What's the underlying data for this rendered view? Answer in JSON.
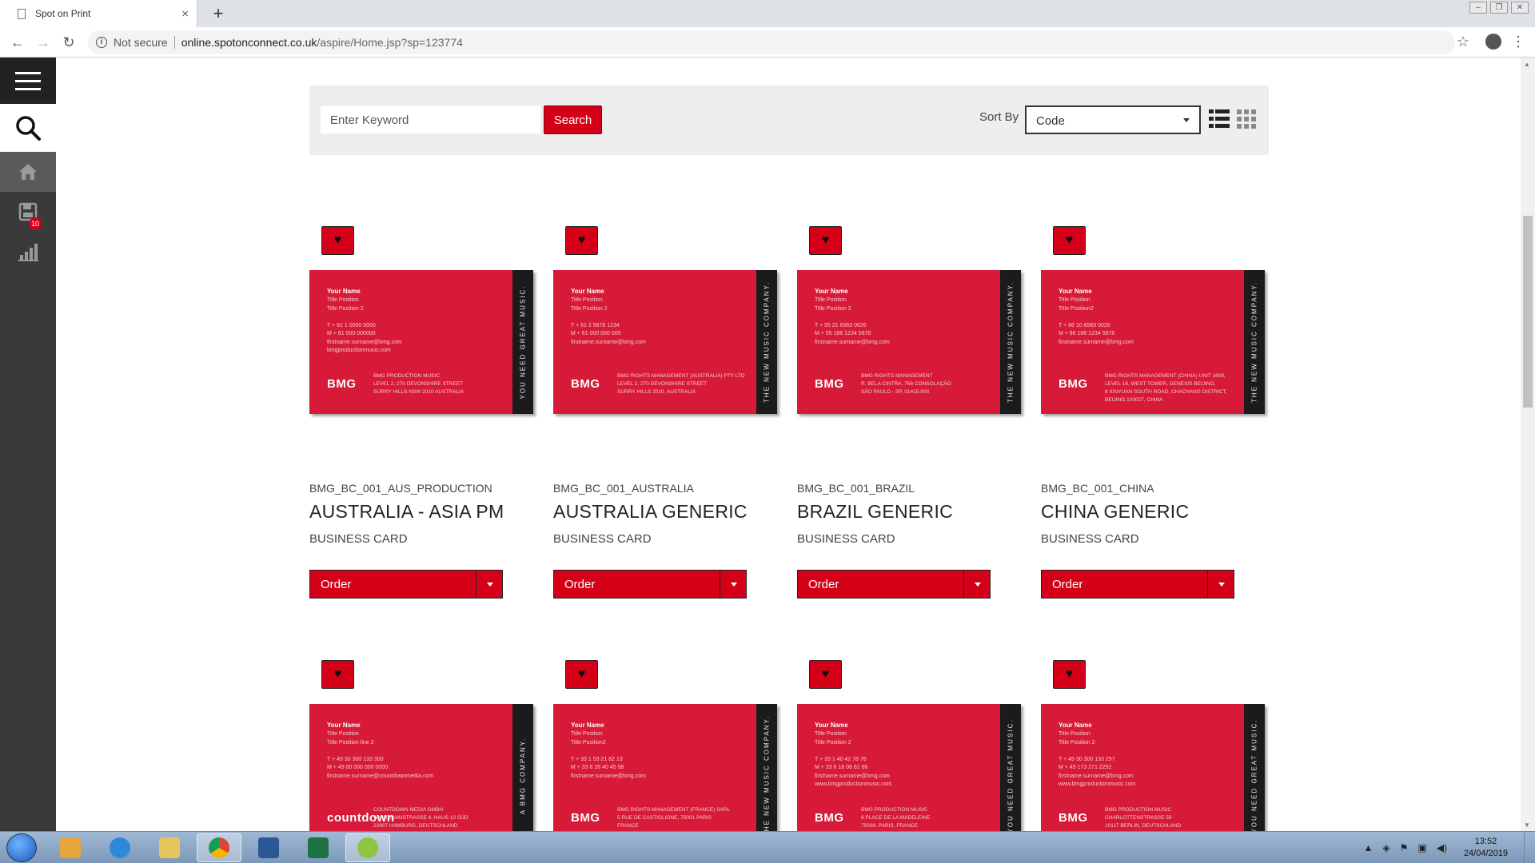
{
  "browser": {
    "tab_title": "Spot on Print",
    "tab_close": "×",
    "new_tab": "+",
    "not_secure": "Not secure",
    "url_host": "online.spotonconnect.co.uk",
    "url_path": "/aspire/Home.jsp?sp=123774"
  },
  "sidebar": {
    "cart_badge": "10"
  },
  "search": {
    "placeholder": "Enter Keyword",
    "button": "Search",
    "sort_label": "Sort By",
    "sort_value": "Code"
  },
  "products": [
    {
      "code": "BMG_BC_001_AUS_PRODUCTION",
      "name": "AUSTRALIA - ASIA PM",
      "type": "BUSINESS CARD",
      "order_label": "Order",
      "card": {
        "person": "Your Name",
        "lines": [
          "Title Position",
          "Title Position 2",
          "",
          "T  + 61 1 0000 0000",
          "M + 61 000 000000",
          "firstname.surname@bmg.com",
          "bmgproductionmusic.com"
        ],
        "logo": "BMG",
        "address": [
          "BMG PRODUCTION MUSIC",
          "LEVEL 2, 270 DEVONSHIRE STREET",
          "SURRY HILLS NSW 2010 AUSTRALIA"
        ],
        "stripe": "YOU NEED GREAT MUSIC."
      }
    },
    {
      "code": "BMG_BC_001_AUSTRALIA",
      "name": "AUSTRALIA GENERIC",
      "type": "BUSINESS CARD",
      "order_label": "Order",
      "card": {
        "person": "Your Name",
        "lines": [
          "Title Position",
          "Title Position 2",
          "",
          "T  + 61 2 5678 1234",
          "M + 61 000 000 000",
          "firstname.surname@bmg.com"
        ],
        "logo": "BMG",
        "address": [
          "BMG RIGHTS MANAGEMENT (AUSTRALIA) PTY LTD",
          "LEVEL 2, 270 DEVONSHIRE STREET",
          "SURRY HILLS 2010, AUSTRALIA"
        ],
        "stripe": "THE NEW MUSIC COMPANY."
      }
    },
    {
      "code": "BMG_BC_001_BRAZIL",
      "name": "BRAZIL GENERIC",
      "type": "BUSINESS CARD",
      "order_label": "Order",
      "card": {
        "person": "Your Name",
        "lines": [
          "Title Position",
          "Title Position 2",
          "",
          "T  + 55 21 6563 0026",
          "M + 55 186 1234 5678",
          "firstname.surname@bmg.com"
        ],
        "logo": "BMG",
        "address": [
          "BMG RIGHTS MANAGEMENT",
          "R. BELA CINTRA, 768 CONSOLAÇÃO",
          "SÃO PAULO - SP, 01415-000"
        ],
        "stripe": "THE NEW MUSIC COMPANY."
      }
    },
    {
      "code": "BMG_BC_001_CHINA",
      "name": "CHINA GENERIC",
      "type": "BUSINESS CARD",
      "order_label": "Order",
      "card": {
        "person": "Your Name",
        "lines": [
          "Title Position",
          "Title Position2",
          "",
          "T  + 86 10 6563 0026",
          "M + 86 186 1234 5678",
          "firstname.surname@bmg.com"
        ],
        "logo": "BMG",
        "address": [
          "BMG RIGHTS MANAGEMENT (CHINA) UNIT 1609,",
          "LEVEL 16, WEST TOWER, GENESIS BEIJING,",
          "8 XINYUAN SOUTH ROAD, CHAOYANG DISTRICT,",
          "BEIJING 100027, CHINA"
        ],
        "stripe": "THE NEW MUSIC COMPANY."
      }
    },
    {
      "card": {
        "person": "Your Name",
        "lines": [
          "Title Position",
          "Title Position line 2",
          "",
          "T  + 49 30 300 133 300",
          "M + 49 00 000 000 0000",
          "firstname.surname@countdownmedia.com"
        ],
        "logo": "countdown",
        "address": [
          "COUNTDOWN MEDIA GMBH",
          "WICHMANNSTRASSE 4, HAUS 10 SÜD",
          "22607 HAMBURG, DEUTSCHLAND"
        ],
        "stripe": "A BMG COMPANY."
      }
    },
    {
      "card": {
        "person": "Your Name",
        "lines": [
          "Title Position",
          "Title Position2",
          "",
          "T  + 33 1 53 21 82 13",
          "M + 33 6 28 40 45 98",
          "firstname.surname@bmg.com"
        ],
        "logo": "BMG",
        "address": [
          "BMG RIGHTS MANAGEMENT (FRANCE) SARL",
          "5 RUE DE CASTIGLIONE, 75001 PARIS",
          "FRANCE"
        ],
        "stripe": "THE NEW MUSIC COMPANY."
      }
    },
    {
      "card": {
        "person": "Your Name",
        "lines": [
          "Title Position",
          "Title Position 2",
          "",
          "T  + 33 1 40 42 78 76",
          "M + 33 6 18 06 62 86",
          "firstname.surname@bmg.com",
          "www.bmgproductionmusic.com"
        ],
        "logo": "BMG",
        "address": [
          "BMG PRODUCTION MUSIC",
          "8 PLACE DE LA MADELEINE",
          "75008, PARIS, FRANCE"
        ],
        "stripe": "YOU NEED GREAT MUSIC."
      }
    },
    {
      "card": {
        "person": "Your Name",
        "lines": [
          "Title Position",
          "Title Position 2",
          "",
          "T  + 49 30 300 133 257",
          "M + 49 173 271 2292",
          "firstname.surname@bmg.com",
          "www.bmgproductionmusic.com"
        ],
        "logo": "BMG",
        "address": [
          "BMG PRODUCTION MUSIC",
          "CHARLOTTENSTRASSE 59",
          "10117 BERLIN, DEUTSCHLAND"
        ],
        "stripe": "YOU NEED GREAT MUSIC."
      }
    }
  ],
  "taskbar": {
    "time": "13:52",
    "date": "24/04/2019"
  },
  "colors": {
    "brand_red": "#d40018",
    "card_red": "#d71a37",
    "sidebar": "#3a3a3a"
  }
}
